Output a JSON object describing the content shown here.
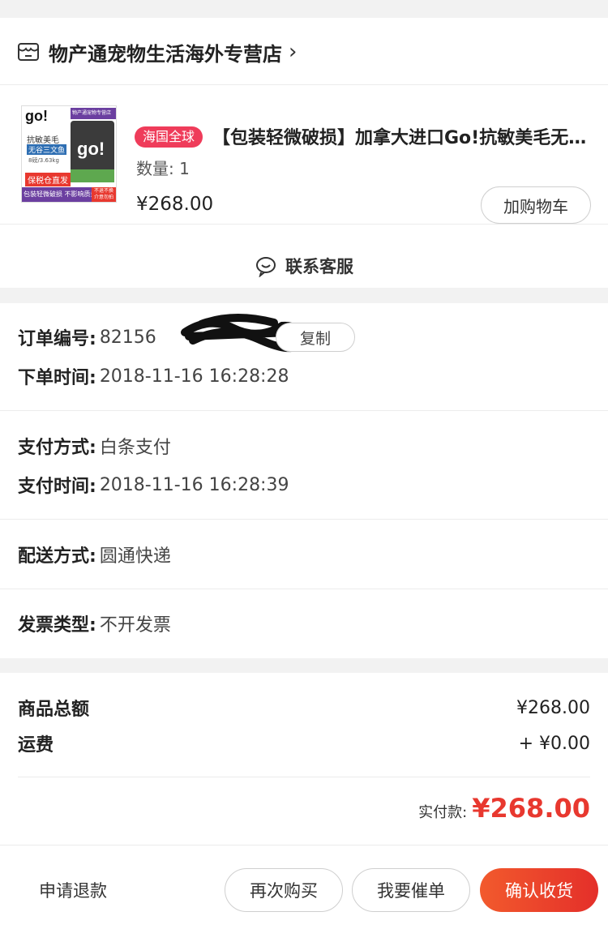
{
  "shop": {
    "name": "物产通宠物生活海外专营店",
    "arrow": "›"
  },
  "product": {
    "image": {
      "brand": "go!",
      "line1": "抗敏美毛",
      "line2": "无谷三文鱼",
      "weight": "8磅/3.63kg",
      "store_label": "物产通宠物专营店",
      "red_label": "保税仓直发",
      "bottom_note": "包装轻微破损 不影响质量",
      "bottom_right": "不退不换 介意勿拍"
    },
    "tag": "海国全球",
    "title": "【包装轻微破损】加拿大进口Go!抗敏美毛无谷三文鱼",
    "quantity": "数量: 1",
    "price": "¥268.00",
    "cart_button": "加购物车"
  },
  "contact": {
    "label": "联系客服"
  },
  "order": {
    "number_label": "订单编号:",
    "number_value": "82156",
    "copy_button": "复制",
    "time_label": "下单时间:",
    "time_value": "2018-11-16 16:28:28",
    "pay_method_label": "支付方式:",
    "pay_method_value": "白条支付",
    "pay_time_label": "支付时间:",
    "pay_time_value": "2018-11-16 16:28:39",
    "delivery_label": "配送方式:",
    "delivery_value": "圆通快递",
    "invoice_label": "发票类型:",
    "invoice_value": "不开发票"
  },
  "summary": {
    "goods_total_label": "商品总额",
    "goods_total_value": "¥268.00",
    "shipping_label": "运费",
    "shipping_value": "+ ¥0.00",
    "paid_label": "实付款:",
    "paid_value": "¥268.00"
  },
  "actions": {
    "refund": "申请退款",
    "rebuy": "再次购买",
    "urge": "我要催单",
    "confirm": "确认收货"
  },
  "colors": {
    "accent": "#e8382f",
    "tag": "#ef3c5a"
  }
}
